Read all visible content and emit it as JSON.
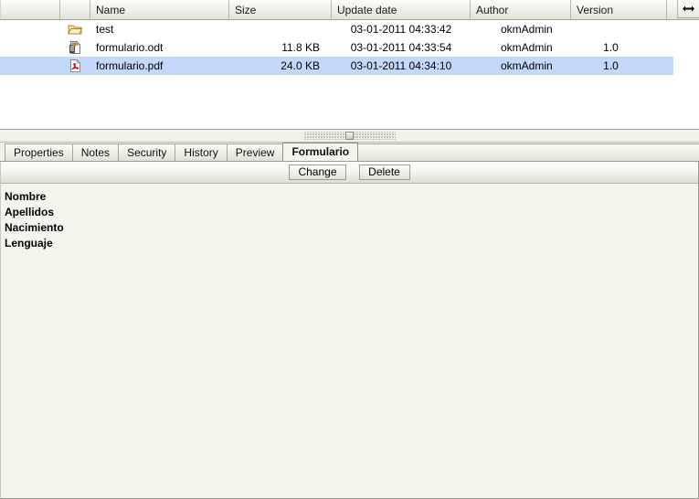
{
  "file_grid": {
    "columns": [
      {
        "key": "select",
        "label": ""
      },
      {
        "key": "icon",
        "label": ""
      },
      {
        "key": "name",
        "label": "Name"
      },
      {
        "key": "size",
        "label": "Size"
      },
      {
        "key": "date",
        "label": "Update date"
      },
      {
        "key": "author",
        "label": "Author"
      },
      {
        "key": "version",
        "label": "Version"
      }
    ],
    "column_chooser_icon": "resize-horizontal-icon",
    "rows": [
      {
        "icon": "folder-icon",
        "name": "test",
        "size": "",
        "date": "03-01-2011 04:33:42",
        "author": "okmAdmin",
        "version": "",
        "selected": false
      },
      {
        "icon": "odt-document-icon",
        "name": "formulario.odt",
        "size": "11.8 KB",
        "date": "03-01-2011 04:33:54",
        "author": "okmAdmin",
        "version": "1.0",
        "selected": false
      },
      {
        "icon": "pdf-document-icon",
        "name": "formulario.pdf",
        "size": "24.0 KB",
        "date": "03-01-2011 04:34:10",
        "author": "okmAdmin",
        "version": "1.0",
        "selected": true
      }
    ],
    "selection_color": "#c4d8fb"
  },
  "splitter": {
    "icon": "splitter-grip-icon"
  },
  "tabs": [
    {
      "label": "Properties",
      "active": false
    },
    {
      "label": "Notes",
      "active": false
    },
    {
      "label": "Security",
      "active": false
    },
    {
      "label": "History",
      "active": false
    },
    {
      "label": "Preview",
      "active": false
    },
    {
      "label": "Formulario",
      "active": true
    }
  ],
  "toolbar": {
    "change_label": "Change",
    "delete_label": "Delete"
  },
  "form": {
    "fields": [
      {
        "label": "Nombre"
      },
      {
        "label": "Apellidos"
      },
      {
        "label": "Nacimiento"
      },
      {
        "label": "Lenguaje"
      }
    ]
  }
}
